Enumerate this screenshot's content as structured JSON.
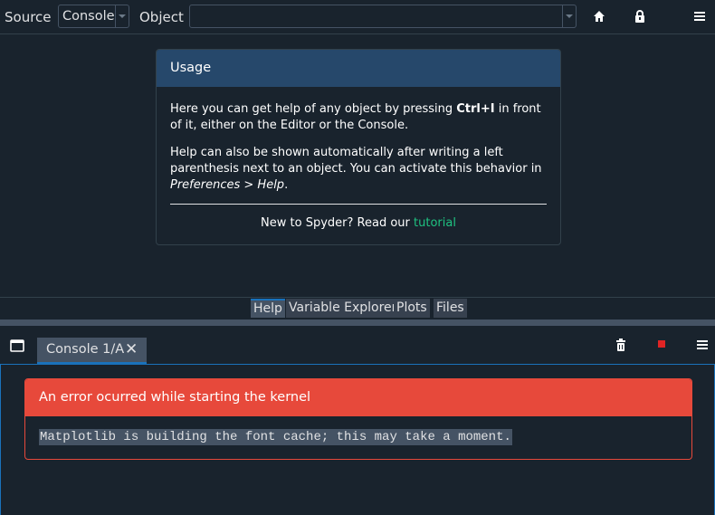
{
  "help_toolbar": {
    "source_label": "Source",
    "source_value": "Console",
    "object_label": "Object",
    "object_value": ""
  },
  "usage_card": {
    "title": "Usage",
    "p1_before": "Here you can get help of any object by pressing ",
    "p1_shortcut": "Ctrl+I",
    "p1_after": " in front of it, either on the Editor or the Console.",
    "p2_before": "Help can also be shown automatically after writing a left parenthesis next to an object. You can activate this behavior in ",
    "p2_pref": "Preferences > Help",
    "p2_after": ".",
    "footer_text": "New to Spyder? Read our ",
    "footer_link": "tutorial"
  },
  "pane_tabs": [
    "Help",
    "Variable Explorer",
    "Plots",
    "Files"
  ],
  "active_pane_tab": "Help",
  "console": {
    "tab_label": "Console 1/A",
    "tab_close": "✕",
    "error_title": "An error ocurred while starting the kernel",
    "error_message": "Matplotlib is building the font cache; this may take a moment."
  },
  "icons": {
    "home": "home-icon",
    "lock": "lock-icon",
    "options": "hamburger-menu-icon",
    "browse_tabs": "browse-tabs-icon",
    "trash": "trash-icon",
    "stop": "stop-icon"
  },
  "colors": {
    "background": "#19232d",
    "usage_header": "#26486b",
    "error_red": "#e7493b",
    "accent_blue": "#1a72bb",
    "link_green": "#1fc281",
    "stop_red": "#e02424"
  }
}
